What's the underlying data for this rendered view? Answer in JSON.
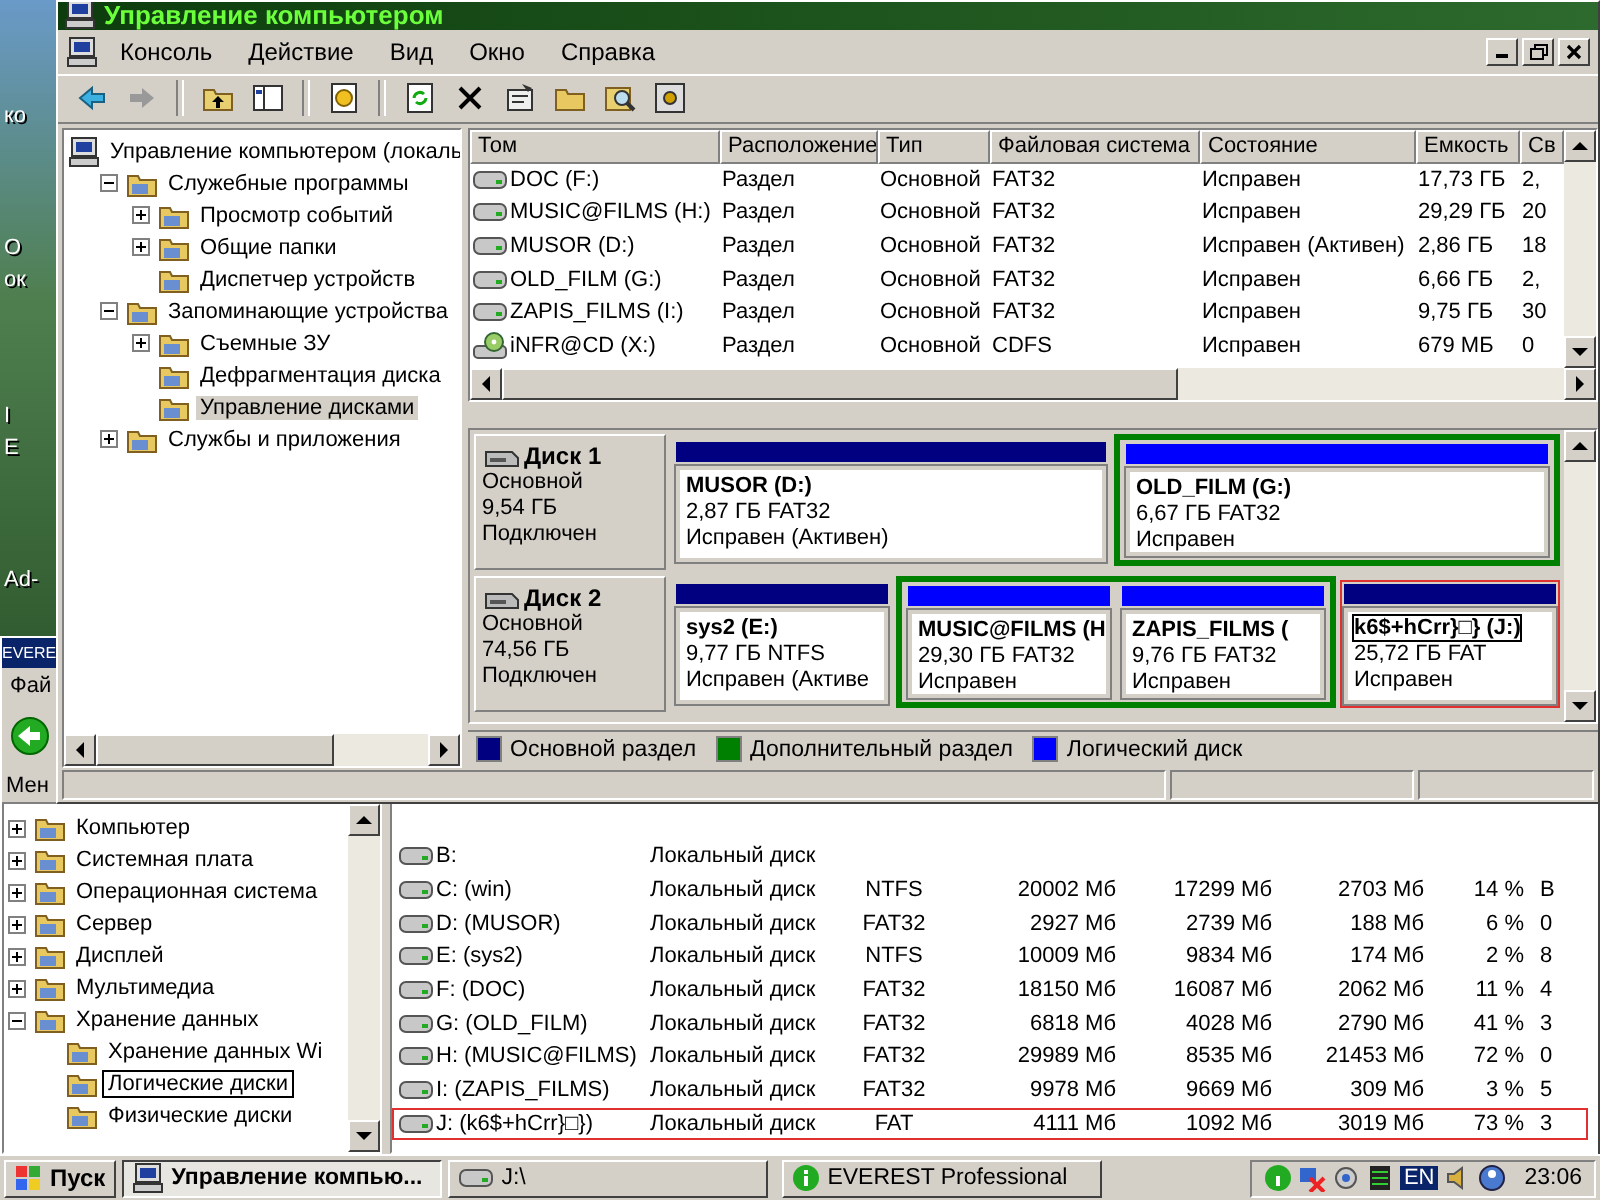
{
  "desktop": {
    "labels": [
      "ко",
      "О",
      "ок",
      "I",
      "E",
      "Ad-"
    ]
  },
  "main_window": {
    "title": "Управление компьютером",
    "menu": [
      "Консоль",
      "Действие",
      "Вид",
      "Окно",
      "Справка"
    ],
    "tree": {
      "label": "Управление компьютером (локаль",
      "selected": false,
      "children": [
        {
          "label": "Служебные программы",
          "selected": false,
          "expanded": true,
          "children": [
            {
              "label": "Просмотр событий",
              "selected": false,
              "expanded": false
            },
            {
              "label": "Общие папки",
              "selected": false,
              "expanded": false
            },
            {
              "label": "Диспетчер устройств",
              "selected": false
            }
          ]
        },
        {
          "label": "Запоминающие устройства",
          "selected": false,
          "expanded": true,
          "children": [
            {
              "label": "Съемные ЗУ",
              "selected": false,
              "expanded": false
            },
            {
              "label": "Дефрагментация диска",
              "selected": false
            },
            {
              "label": "Управление дисками",
              "selected": true
            }
          ]
        },
        {
          "label": "Службы и приложения",
          "selected": false,
          "expanded": false
        }
      ]
    },
    "volumes": {
      "columns": [
        "Том",
        "Расположение",
        "Тип",
        "Файловая система",
        "Состояние",
        "Емкость",
        "Св"
      ],
      "rows": [
        {
          "kind": "disk",
          "cells": [
            "DOC (F:)",
            "Раздел",
            "Основной",
            "FAT32",
            "Исправен",
            "17,73 ГБ",
            "2,"
          ]
        },
        {
          "kind": "disk",
          "cells": [
            "MUSIC@FILMS (H:)",
            "Раздел",
            "Основной",
            "FAT32",
            "Исправен",
            "29,29 ГБ",
            "20"
          ]
        },
        {
          "kind": "disk",
          "cells": [
            "MUSOR (D:)",
            "Раздел",
            "Основной",
            "FAT32",
            "Исправен (Активен)",
            "2,86 ГБ",
            "18"
          ]
        },
        {
          "kind": "disk",
          "cells": [
            "OLD_FILM (G:)",
            "Раздел",
            "Основной",
            "FAT32",
            "Исправен",
            "6,66 ГБ",
            "2,"
          ]
        },
        {
          "kind": "disk",
          "cells": [
            "ZAPIS_FILMS (I:)",
            "Раздел",
            "Основной",
            "FAT32",
            "Исправен",
            "9,75 ГБ",
            "30"
          ]
        },
        {
          "kind": "cd",
          "cells": [
            "iNFR@CD (X:)",
            "Раздел",
            "Основной",
            "CDFS",
            "Исправен",
            "679 МБ",
            "0"
          ]
        }
      ]
    },
    "disks": [
      {
        "name": "Диск 1",
        "type": "Основной",
        "size": "9,54 ГБ",
        "status": "Подключен",
        "partitions": [
          {
            "kind": "primary",
            "name": "MUSOR (D:)",
            "size": "2,87 ГБ FAT32",
            "status": "Исправен (Активен)",
            "focused": false,
            "highlighted": false
          },
          {
            "kind": "extended",
            "children": [
              {
                "kind": "logical",
                "name": "OLD_FILM (G:)",
                "size": "6,67 ГБ FAT32",
                "status": "Исправен",
                "focused": false,
                "highlighted": false
              }
            ]
          }
        ]
      },
      {
        "name": "Диск 2",
        "type": "Основной",
        "size": "74,56 ГБ",
        "status": "Подключен",
        "partitions": [
          {
            "kind": "primary",
            "name": "sys2 (E:)",
            "size": "9,77 ГБ NTFS",
            "status": "Исправен (Активе",
            "focused": false,
            "highlighted": false
          },
          {
            "kind": "extended",
            "children": [
              {
                "kind": "logical",
                "name": "MUSIC@FILMS (H",
                "size": "29,30 ГБ FAT32",
                "status": "Исправен",
                "focused": false,
                "highlighted": false
              },
              {
                "kind": "logical",
                "name": "ZAPIS_FILMS (",
                "size": "9,76 ГБ FAT32",
                "status": "Исправен",
                "focused": false,
                "highlighted": false
              }
            ]
          },
          {
            "kind": "primary",
            "name": "k6$+hCrr}□} (J:)",
            "size": "25,72 ГБ FAT",
            "status": "Исправен",
            "focused": true,
            "highlighted": true
          }
        ]
      }
    ],
    "legend": [
      {
        "label": "Основной раздел",
        "color": "#000080"
      },
      {
        "label": "Дополнительный раздел",
        "color": "#008000"
      },
      {
        "label": "Логический диск",
        "color": "#0000ff"
      }
    ]
  },
  "everest": {
    "title": "EVERE",
    "menu": "Фай",
    "toolbar_label": "Мен",
    "tree": [
      {
        "label": "Компьютер",
        "selected": false,
        "expanded": false
      },
      {
        "label": "Системная плата",
        "selected": false,
        "expanded": false
      },
      {
        "label": "Операционная система",
        "selected": false,
        "expanded": false
      },
      {
        "label": "Сервер",
        "selected": false,
        "expanded": false
      },
      {
        "label": "Дисплей",
        "selected": false,
        "expanded": false
      },
      {
        "label": "Мультимедиа",
        "selected": false,
        "expanded": false
      },
      {
        "label": "Хранение данных",
        "selected": false,
        "expanded": true,
        "children": [
          {
            "label": "Хранение данных Wi",
            "selected": false
          },
          {
            "label": "Логические диски",
            "selected": true
          },
          {
            "label": "Физические диски",
            "selected": false
          }
        ]
      }
    ],
    "rows": [
      {
        "highlighted": false,
        "cells": [
          "B:",
          "Локальный диск"
        ]
      },
      {
        "highlighted": false,
        "cells": [
          "C: (win)",
          "Локальный диск",
          "NTFS",
          "20002 Мб",
          "17299 Мб",
          "2703 Мб",
          "14 %",
          "В"
        ]
      },
      {
        "highlighted": false,
        "cells": [
          "D: (MUSOR)",
          "Локальный диск",
          "FAT32",
          "2927 Мб",
          "2739 Мб",
          "188 Мб",
          "6 %",
          "0"
        ]
      },
      {
        "highlighted": false,
        "cells": [
          "E: (sys2)",
          "Локальный диск",
          "NTFS",
          "10009 Мб",
          "9834 Мб",
          "174 Мб",
          "2 %",
          "8"
        ]
      },
      {
        "highlighted": false,
        "cells": [
          "F: (DOC)",
          "Локальный диск",
          "FAT32",
          "18150 Мб",
          "16087 Мб",
          "2062 Мб",
          "11 %",
          "4"
        ]
      },
      {
        "highlighted": false,
        "cells": [
          "G: (OLD_FILM)",
          "Локальный диск",
          "FAT32",
          "6818 Мб",
          "4028 Мб",
          "2790 Мб",
          "41 %",
          "3"
        ]
      },
      {
        "highlighted": false,
        "cells": [
          "H: (MUSIC@FILMS)",
          "Локальный диск",
          "FAT32",
          "29989 Мб",
          "8535 Мб",
          "21453 Мб",
          "72 %",
          "0"
        ]
      },
      {
        "highlighted": false,
        "cells": [
          "I: (ZAPIS_FILMS)",
          "Локальный диск",
          "FAT32",
          "9978 Мб",
          "9669 Мб",
          "309 Мб",
          "3 %",
          "5"
        ]
      },
      {
        "highlighted": true,
        "cells": [
          "J: (k6$+hCrr}□})",
          "Локальный диск",
          "FAT",
          "4111 Мб",
          "1092 Мб",
          "3019 Мб",
          "73 %",
          "3"
        ]
      }
    ]
  },
  "taskbar": {
    "start": "Пуск",
    "tasks": [
      {
        "label": "Управление компью...",
        "selected": true,
        "kind": "computer"
      },
      {
        "label": "J:\\",
        "selected": false,
        "kind": "drive"
      },
      {
        "label": "EVEREST Professional",
        "selected": false,
        "kind": "info"
      }
    ],
    "language": "EN",
    "clock": "23:06"
  }
}
